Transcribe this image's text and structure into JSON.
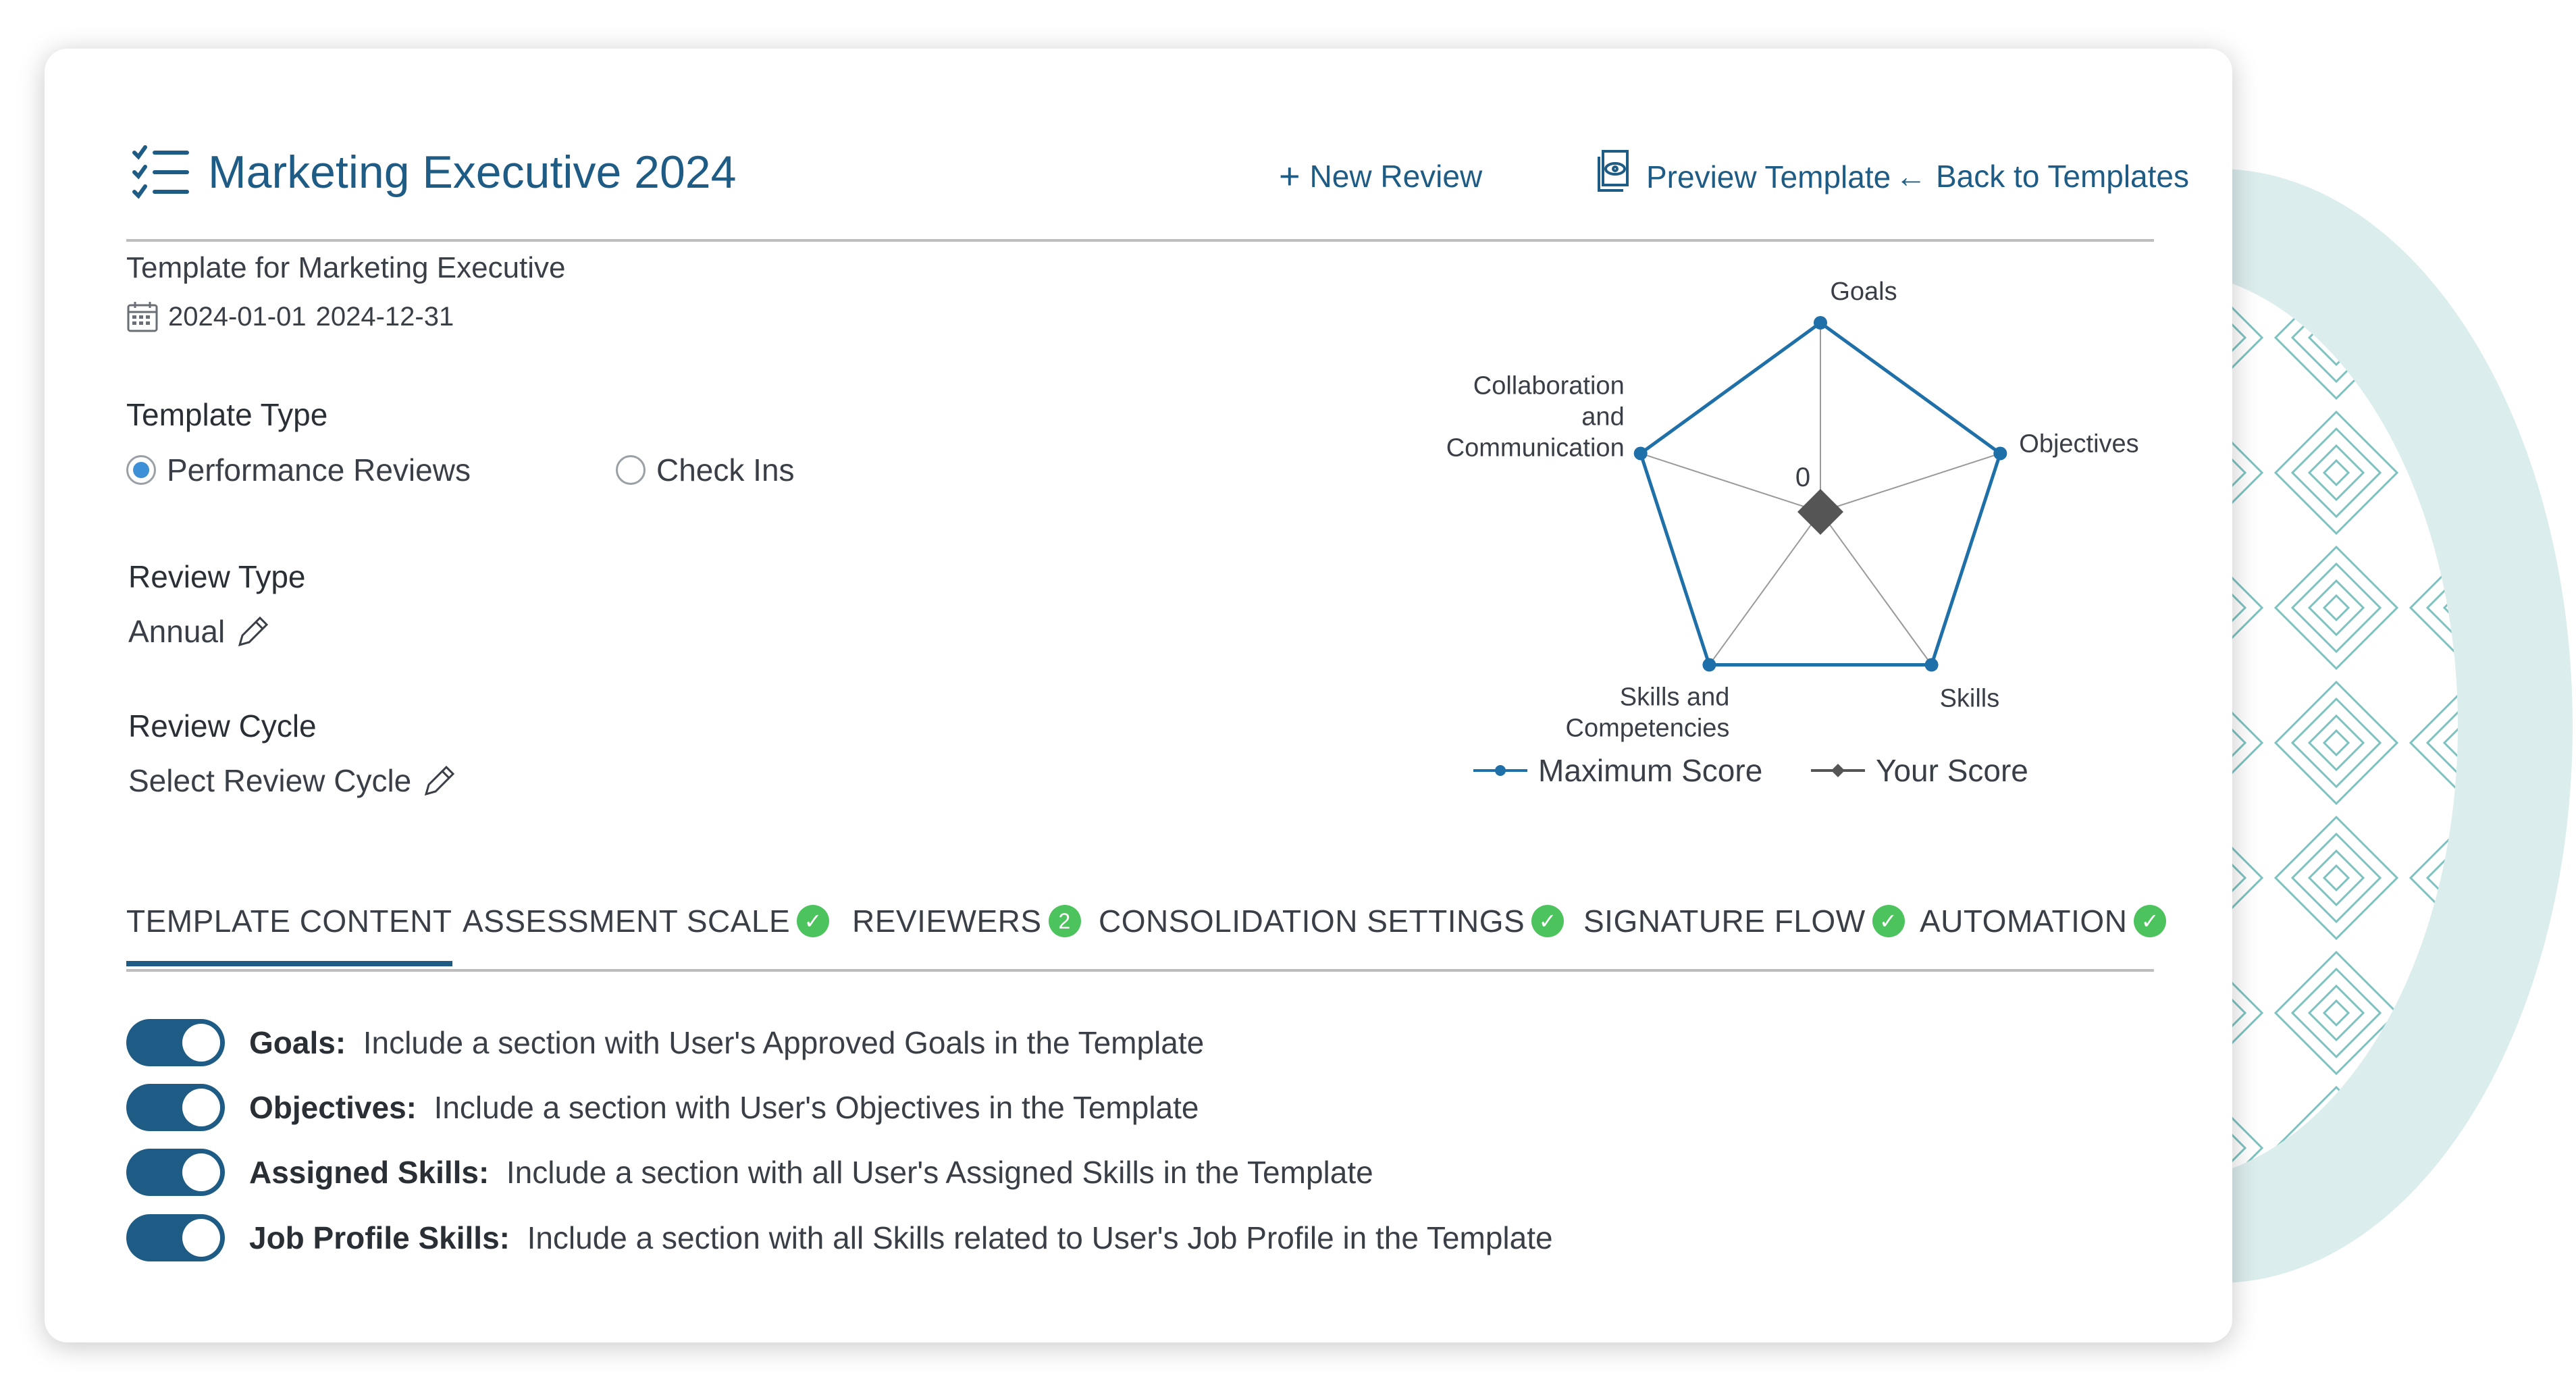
{
  "header": {
    "title": "Marketing Executive 2024",
    "new_review": "New Review",
    "preview_template": "Preview Template",
    "back_to_templates": "Back to Templates"
  },
  "info": {
    "subtitle": "Template for Marketing Executive",
    "start_date": "2024-01-01",
    "end_date": "2024-12-31"
  },
  "template_type": {
    "label": "Template Type",
    "options": [
      "Performance Reviews",
      "Check Ins"
    ],
    "selected": "Performance Reviews"
  },
  "review_type": {
    "label": "Review Type",
    "value": "Annual"
  },
  "review_cycle": {
    "label": "Review Cycle",
    "value": "Select Review Cycle"
  },
  "chart_data": {
    "type": "radar",
    "axes": [
      "Goals",
      "Objectives",
      "Skills",
      "Skills and Competencies",
      "Collaboration and Communication"
    ],
    "center_label": "0",
    "series": [
      {
        "name": "Maximum Score",
        "values": [
          1,
          1,
          1,
          1,
          1
        ],
        "color": "#1f6fa8"
      },
      {
        "name": "Your Score",
        "values": [
          0,
          0,
          0,
          0,
          0
        ],
        "color": "#555555"
      }
    ]
  },
  "tabs": [
    {
      "label": "TEMPLATE CONTENT",
      "active": true,
      "badge": ""
    },
    {
      "label": "ASSESSMENT SCALE",
      "active": false,
      "badge": "check"
    },
    {
      "label": "REVIEWERS",
      "active": false,
      "badge": "2"
    },
    {
      "label": "CONSOLIDATION SETTINGS",
      "active": false,
      "badge": "check"
    },
    {
      "label": "SIGNATURE FLOW",
      "active": false,
      "badge": "check"
    },
    {
      "label": "AUTOMATION",
      "active": false,
      "badge": "check"
    }
  ],
  "toggles": [
    {
      "name": "Goals:",
      "desc": "Include a section with User's Approved Goals in the Template",
      "on": true
    },
    {
      "name": "Objectives:",
      "desc": "Include a section with User's Objectives in the Template",
      "on": true
    },
    {
      "name": "Assigned Skills:",
      "desc": "Include a section with all User's Assigned Skills in the Template",
      "on": true
    },
    {
      "name": "Job Profile Skills:",
      "desc": "Include a section with all Skills related to User's Job Profile in the Template",
      "on": true
    }
  ],
  "colors": {
    "primary": "#1f5c85",
    "success": "#4cc35d",
    "radio": "#3d8fd6"
  }
}
